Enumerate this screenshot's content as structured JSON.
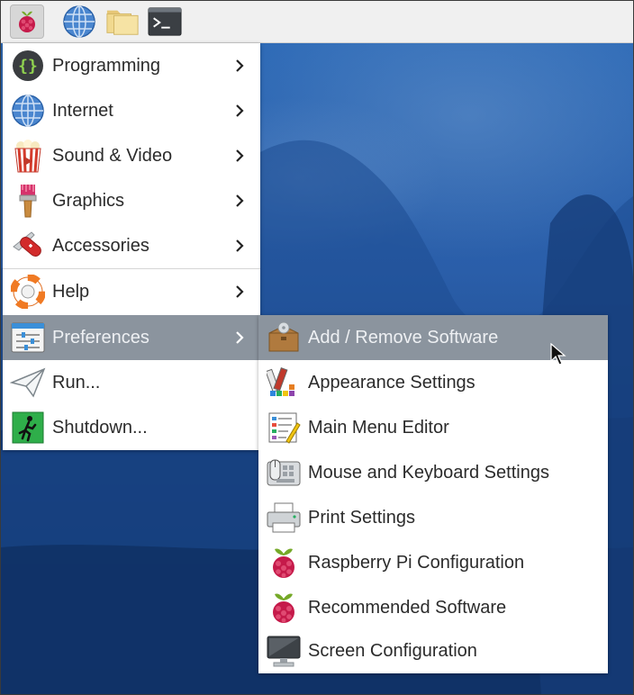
{
  "main_menu": {
    "items": [
      {
        "label": "Programming",
        "icon": "braces-icon",
        "submenu": true
      },
      {
        "label": "Internet",
        "icon": "globe-icon",
        "submenu": true
      },
      {
        "label": "Sound & Video",
        "icon": "popcorn-icon",
        "submenu": true
      },
      {
        "label": "Graphics",
        "icon": "paintbrush-icon",
        "submenu": true
      },
      {
        "label": "Accessories",
        "icon": "pocket-knife-icon",
        "submenu": true
      },
      {
        "label": "Help",
        "icon": "lifebuoy-icon",
        "submenu": true
      },
      {
        "label": "Preferences",
        "icon": "sliders-icon",
        "submenu": true,
        "selected": true
      },
      {
        "label": "Run...",
        "icon": "paper-plane-icon",
        "submenu": false
      },
      {
        "label": "Shutdown...",
        "icon": "exit-icon",
        "submenu": false
      }
    ]
  },
  "preferences_menu": {
    "items": [
      {
        "label": "Add / Remove Software",
        "icon": "package-icon",
        "selected": true
      },
      {
        "label": "Appearance Settings",
        "icon": "palette-icon"
      },
      {
        "label": "Main Menu Editor",
        "icon": "menu-editor-icon"
      },
      {
        "label": "Mouse and Keyboard Settings",
        "icon": "mouse-keyboard-icon"
      },
      {
        "label": "Print Settings",
        "icon": "printer-icon"
      },
      {
        "label": "Raspberry Pi Configuration",
        "icon": "raspberry-icon"
      },
      {
        "label": "Recommended Software",
        "icon": "raspberry-icon"
      },
      {
        "label": "Screen Configuration",
        "icon": "monitor-icon"
      }
    ]
  },
  "colors": {
    "selection": "#8b949e",
    "raspberry": "#c51a4a",
    "leaf": "#75a928"
  }
}
